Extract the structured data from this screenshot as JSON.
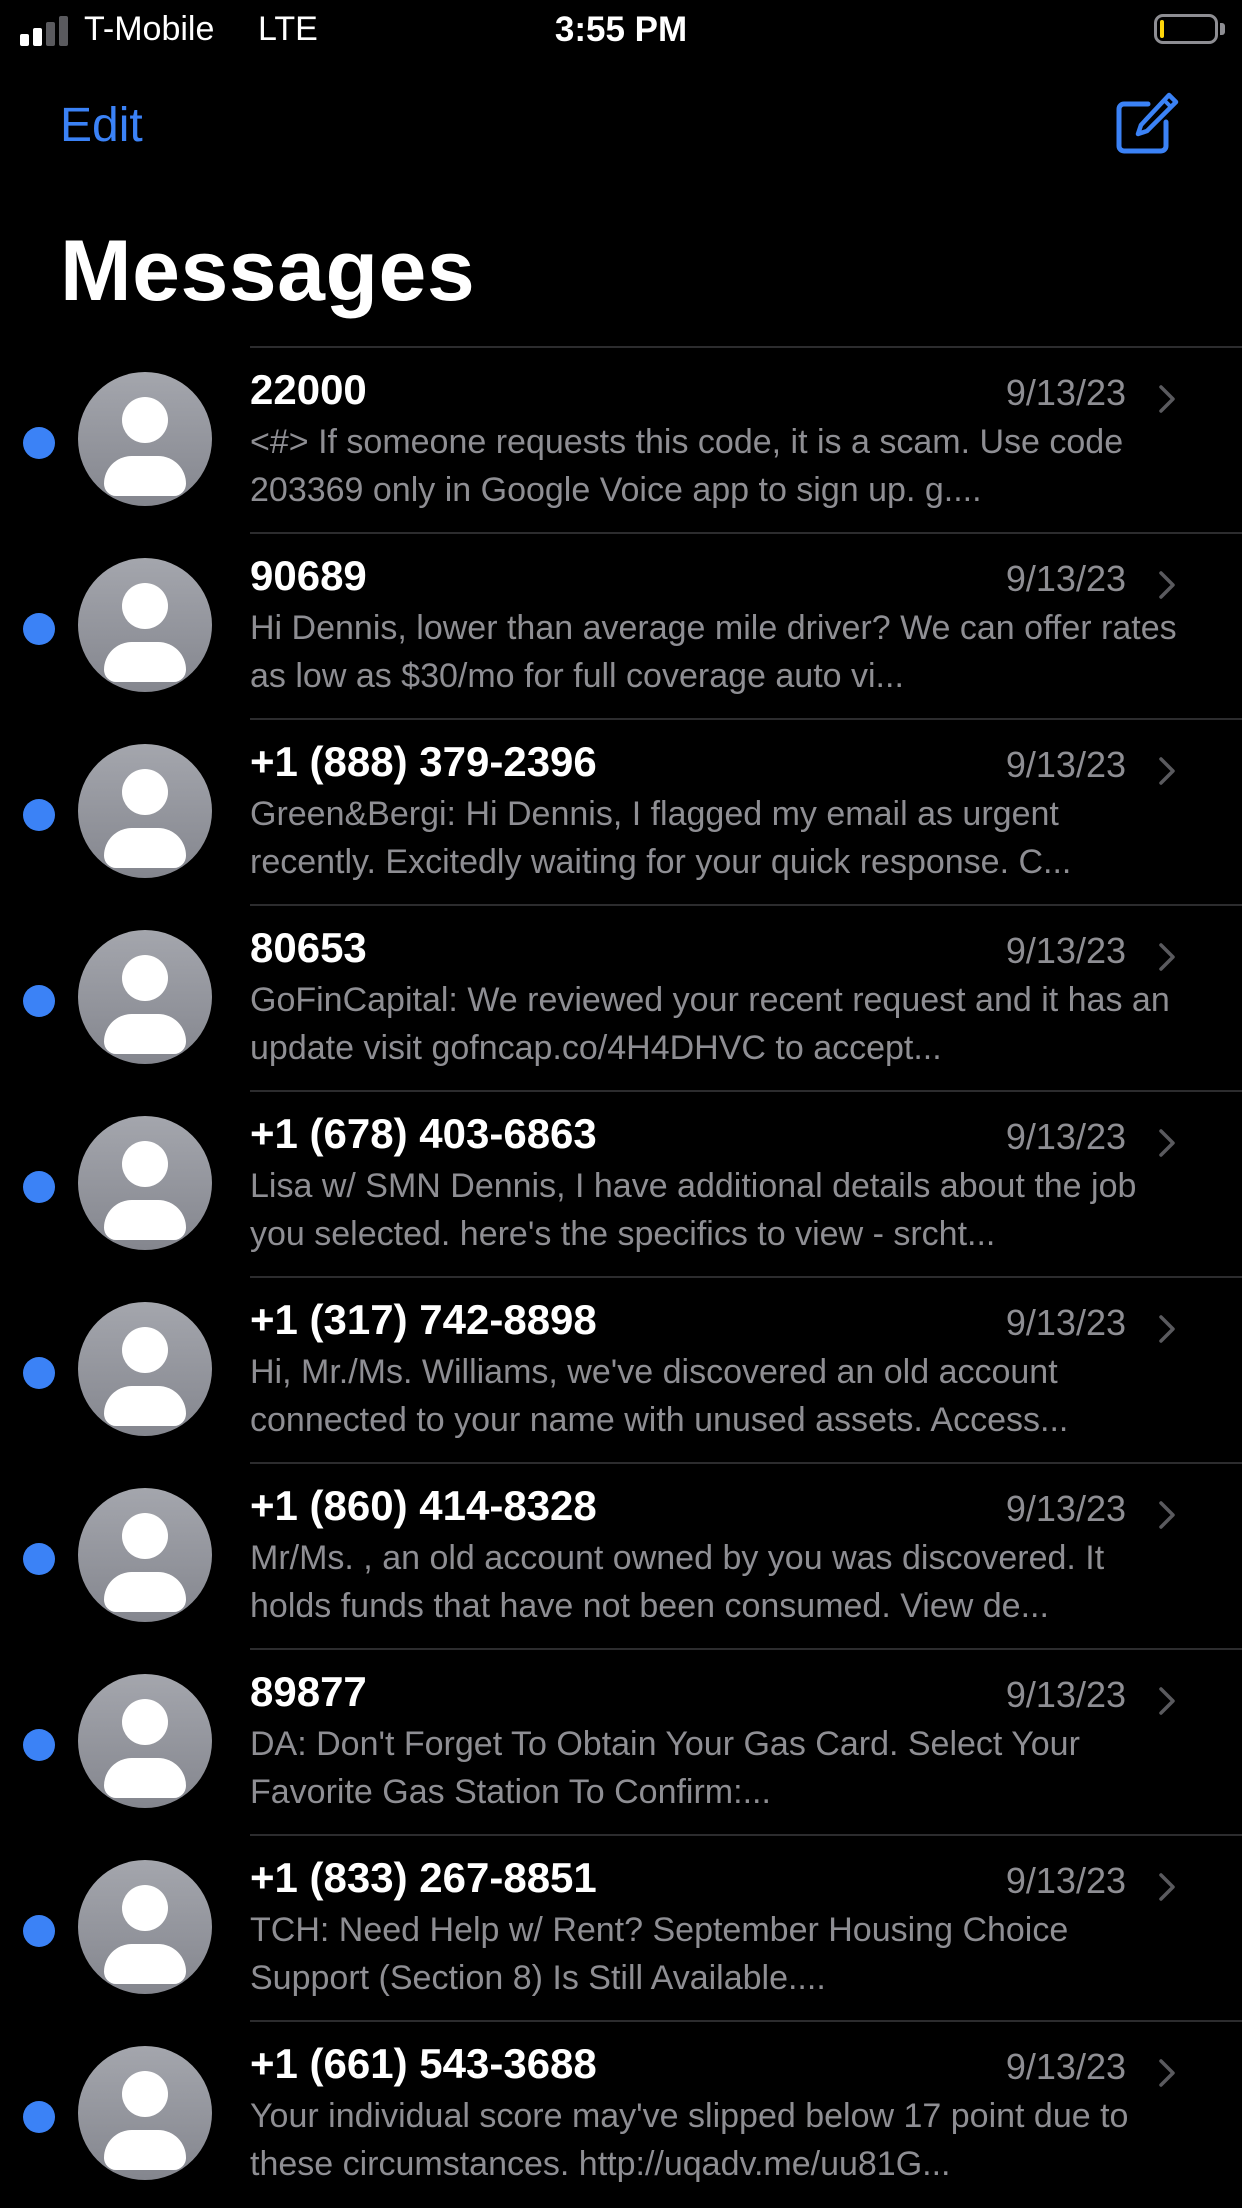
{
  "status_bar": {
    "carrier": "T-Mobile",
    "network": "LTE",
    "time": "3:55 PM",
    "signal_bars_active": 2,
    "signal_bars_total": 4,
    "battery_level": 0.08
  },
  "nav": {
    "edit_label": "Edit",
    "compose_icon": "compose-icon"
  },
  "title": "Messages",
  "colors": {
    "accent": "#3b82f6",
    "secondary_text": "#8e8e93",
    "background": "#000000"
  },
  "conversations": [
    {
      "sender": "22000",
      "date": "9/13/23",
      "unread": true,
      "preview": "<#> If someone requests this code, it is a scam. Use code 203369 only in Google Voice app to sign up. g...."
    },
    {
      "sender": "90689",
      "date": "9/13/23",
      "unread": true,
      "preview": "Hi Dennis, lower than average mile driver? We can offer rates as low as $30/mo for full coverage auto vi..."
    },
    {
      "sender": "+1 (888) 379-2396",
      "date": "9/13/23",
      "unread": true,
      "preview": "Green&Bergi: Hi Dennis, I flagged my email as urgent recently. Excitedly waiting for your quick response. C..."
    },
    {
      "sender": "80653",
      "date": "9/13/23",
      "unread": true,
      "preview": "GoFinCapital: We reviewed your recent request and it has an update visit gofncap.co/4H4DHVC to accept..."
    },
    {
      "sender": "+1 (678) 403-6863",
      "date": "9/13/23",
      "unread": true,
      "preview": "Lisa w/ SMN Dennis, I have additional details about the job you selected. here's the specifics to view - srcht..."
    },
    {
      "sender": "+1 (317) 742-8898",
      "date": "9/13/23",
      "unread": true,
      "preview": "Hi, Mr./Ms. Williams, we've discovered an old account connected to your name with unused assets. Access..."
    },
    {
      "sender": "+1 (860) 414-8328",
      "date": "9/13/23",
      "unread": true,
      "preview": "Mr/Ms. , an old account owned by you was discovered. It holds funds that have not been consumed. View de..."
    },
    {
      "sender": "89877",
      "date": "9/13/23",
      "unread": true,
      "preview": "DA: Don't Forget To Obtain Your Gas Card. Select Your Favorite Gas Station To Confirm:..."
    },
    {
      "sender": "+1 (833) 267-8851",
      "date": "9/13/23",
      "unread": true,
      "preview": "TCH: Need Help w/ Rent? September Housing Choice Support (Section 8) Is Still Available...."
    },
    {
      "sender": "+1 (661) 543-3688",
      "date": "9/13/23",
      "unread": true,
      "preview": "Your individual score may've slipped below 17 point due to these circumstances. http://uqadv.me/uu81G..."
    }
  ]
}
